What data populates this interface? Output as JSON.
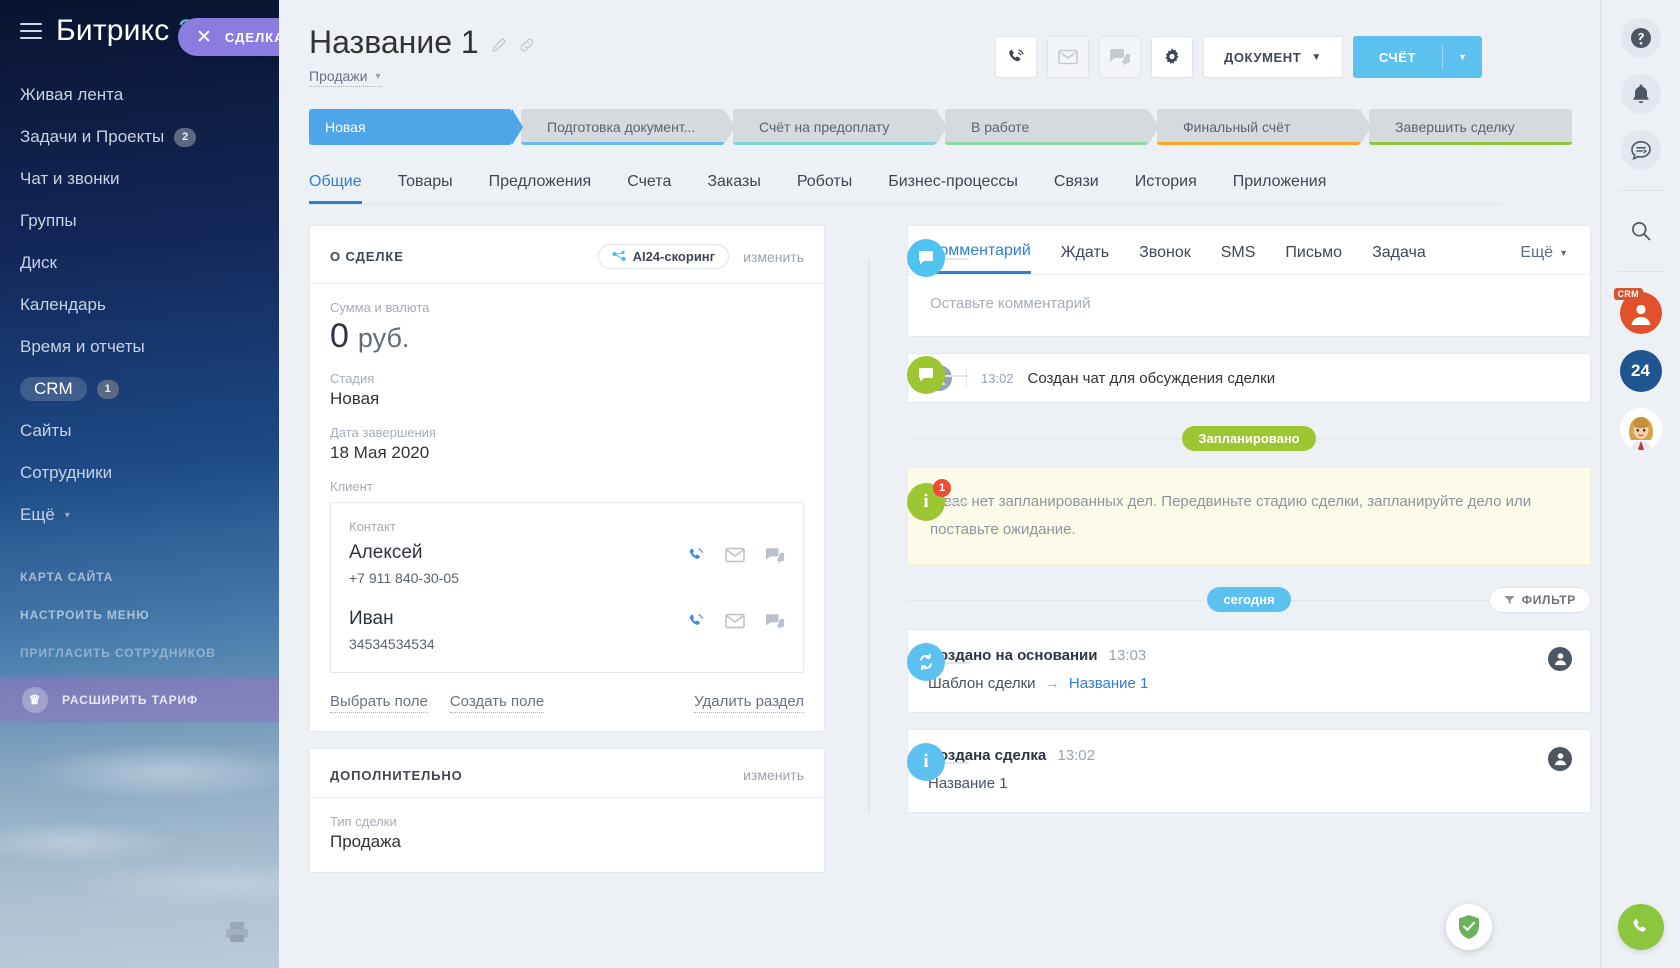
{
  "colors": {
    "accent": "#2f7ed8",
    "stage_selected": "#4ea5e8",
    "bill_button": "#5cc1ee",
    "deal_pill": "#8c7ce0",
    "green": "#8cc63f",
    "today_badge": "#5cc1ee",
    "alert_red": "#ef4c33"
  },
  "sidebar": {
    "logo": "Битрикс",
    "logo_num": "24",
    "deal_pill_label": "СДЕЛКА",
    "items": [
      {
        "label": "Живая лента",
        "badge": "",
        "active": false
      },
      {
        "label": "Задачи и Проекты",
        "badge": "2",
        "active": false
      },
      {
        "label": "Чат и звонки",
        "badge": "",
        "active": false
      },
      {
        "label": "Группы",
        "badge": "",
        "active": false
      },
      {
        "label": "Диск",
        "badge": "",
        "active": false
      },
      {
        "label": "Календарь",
        "badge": "",
        "active": false
      },
      {
        "label": "Время и отчеты",
        "badge": "",
        "active": false
      },
      {
        "label": "CRM",
        "badge": "1",
        "active": true
      },
      {
        "label": "Сайты",
        "badge": "",
        "active": false
      },
      {
        "label": "Сотрудники",
        "badge": "",
        "active": false
      }
    ],
    "more_label": "Ещё",
    "sub_items": [
      {
        "label": "КАРТА САЙТА",
        "dim": false
      },
      {
        "label": "НАСТРОИТЬ МЕНЮ",
        "dim": false
      },
      {
        "label": "ПРИГЛАСИТЬ СОТРУДНИКОВ",
        "dim": true
      }
    ],
    "upgrade_label": "РАСШИРИТЬ ТАРИФ"
  },
  "header": {
    "title": "Название 1",
    "subtitle": "Продажи",
    "actions": {
      "call": "call-icon",
      "email": "email-icon",
      "chat": "chat-icon",
      "settings": "gear-icon",
      "document_label": "ДОКУМЕНТ",
      "bill_label": "СЧЁТ"
    }
  },
  "stages": [
    {
      "label": "Новая",
      "color": "#4ea5e8",
      "selected": true
    },
    {
      "label": "Подготовка документ...",
      "color": "#6db9e8",
      "selected": false
    },
    {
      "label": "Счёт на предоплату",
      "color": "#7fd4d2",
      "selected": false
    },
    {
      "label": "В работе",
      "color": "#8fd9a8",
      "selected": false
    },
    {
      "label": "Финальный счёт",
      "color": "#f5a623",
      "selected": false
    },
    {
      "label": "Завершить сделку",
      "color": "#8cc63f",
      "selected": false
    }
  ],
  "tabs": [
    {
      "label": "Общие",
      "active": true
    },
    {
      "label": "Товары",
      "active": false
    },
    {
      "label": "Предложения",
      "active": false
    },
    {
      "label": "Счета",
      "active": false
    },
    {
      "label": "Заказы",
      "active": false
    },
    {
      "label": "Роботы",
      "active": false
    },
    {
      "label": "Бизнес-процессы",
      "active": false
    },
    {
      "label": "Связи",
      "active": false
    },
    {
      "label": "История",
      "active": false
    },
    {
      "label": "Приложения",
      "active": false
    }
  ],
  "about_card": {
    "title": "О СДЕЛКЕ",
    "ai_chip": "AI24-скоринг",
    "edit_link": "изменить",
    "amount_label": "Сумма и валюта",
    "amount_value": "0",
    "amount_currency": "руб.",
    "stage_label": "Стадия",
    "stage_value": "Новая",
    "close_date_label": "Дата завершения",
    "close_date_value": "18 Мая 2020",
    "client_label": "Клиент",
    "contact_label": "Контакт",
    "contacts": [
      {
        "name": "Алексей",
        "phone": "+7 911 840-30-05"
      },
      {
        "name": "Иван",
        "phone": "34534534534"
      }
    ],
    "select_field": "Выбрать поле",
    "create_field": "Создать поле",
    "delete_section": "Удалить раздел"
  },
  "additional_card": {
    "title": "ДОПОЛНИТЕЛЬНО",
    "edit_link": "изменить",
    "deal_type_label": "Тип сделки",
    "deal_type_value": "Продажа"
  },
  "activity": {
    "tabs": [
      {
        "label": "Комментарий",
        "active": true
      },
      {
        "label": "Ждать",
        "active": false
      },
      {
        "label": "Звонок",
        "active": false
      },
      {
        "label": "SMS",
        "active": false
      },
      {
        "label": "Письмо",
        "active": false
      },
      {
        "label": "Задача",
        "active": false
      }
    ],
    "more_label": "Ещё",
    "comment_placeholder": "Оставьте комментарий",
    "chat_entry": {
      "time": "13:02",
      "text": "Создан чат для обсуждения сделки"
    },
    "planned_badge": "Запланировано",
    "warning_text": "У вас нет запланированных дел. Передвиньте стадию сделки, запланируйте дело или поставьте ожидание.",
    "warning_count": "1",
    "today_badge": "сегодня",
    "filter_label": "ФИЛЬТР",
    "history": [
      {
        "title": "Создано на основании",
        "time": "13:03",
        "body_prefix": "Шаблон сделки",
        "arrow": "→",
        "body_link": "Название 1",
        "icon": "sync-icon"
      },
      {
        "title": "Создана сделка",
        "time": "13:02",
        "body_prefix": "Название 1",
        "arrow": "",
        "body_link": "",
        "icon": "info-icon"
      }
    ]
  },
  "rail": {
    "help": "help-icon",
    "bell": "bell-icon",
    "messages": "messages-icon",
    "search": "search-icon",
    "crm_tag": "CRM",
    "b24": "24"
  }
}
